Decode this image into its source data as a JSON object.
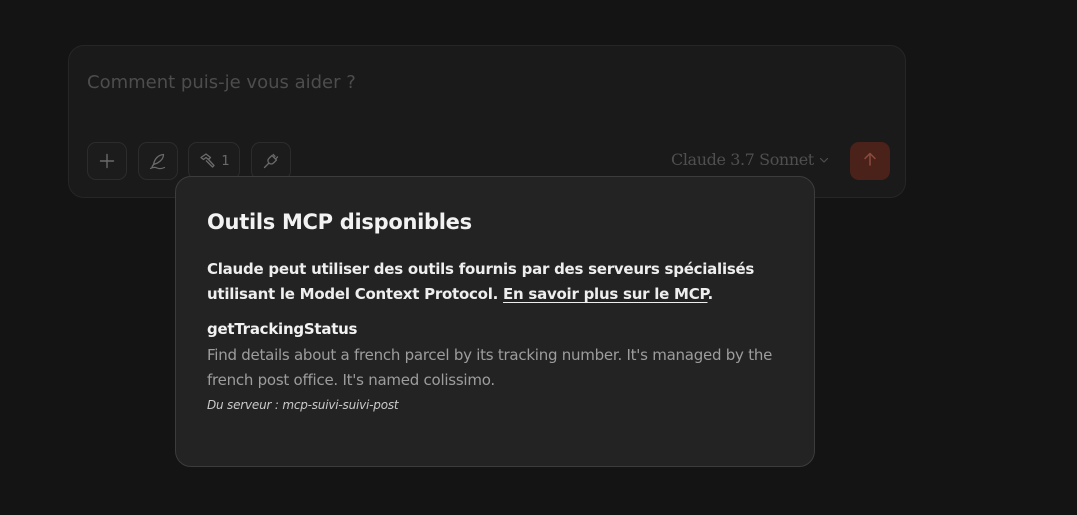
{
  "composer": {
    "placeholder": "Comment puis-je vous aider ?",
    "tools_count": "1",
    "model": "Claude 3.7 Sonnet",
    "accent_color": "#4a2219"
  },
  "icons": {
    "add": "plus-icon",
    "style": "quill-icon",
    "tools": "hammer-icon",
    "connect": "plug-icon",
    "model_dropdown": "chevron-down-icon",
    "send": "arrow-up-icon"
  },
  "mcp_popover": {
    "title": "Outils MCP disponibles",
    "description": "Claude peut utiliser des outils fournis par des serveurs spécialisés utilisant le Model Context Protocol. ",
    "learn_more_link": "En savoir plus sur le MCP",
    "learn_more_suffix": ".",
    "tools": [
      {
        "name": "getTrackingStatus",
        "description": "Find details about a french parcel by its tracking number. It's managed by the french post office. It's named colissimo.",
        "server": "Du serveur : mcp-suivi-suivi-post"
      }
    ]
  }
}
